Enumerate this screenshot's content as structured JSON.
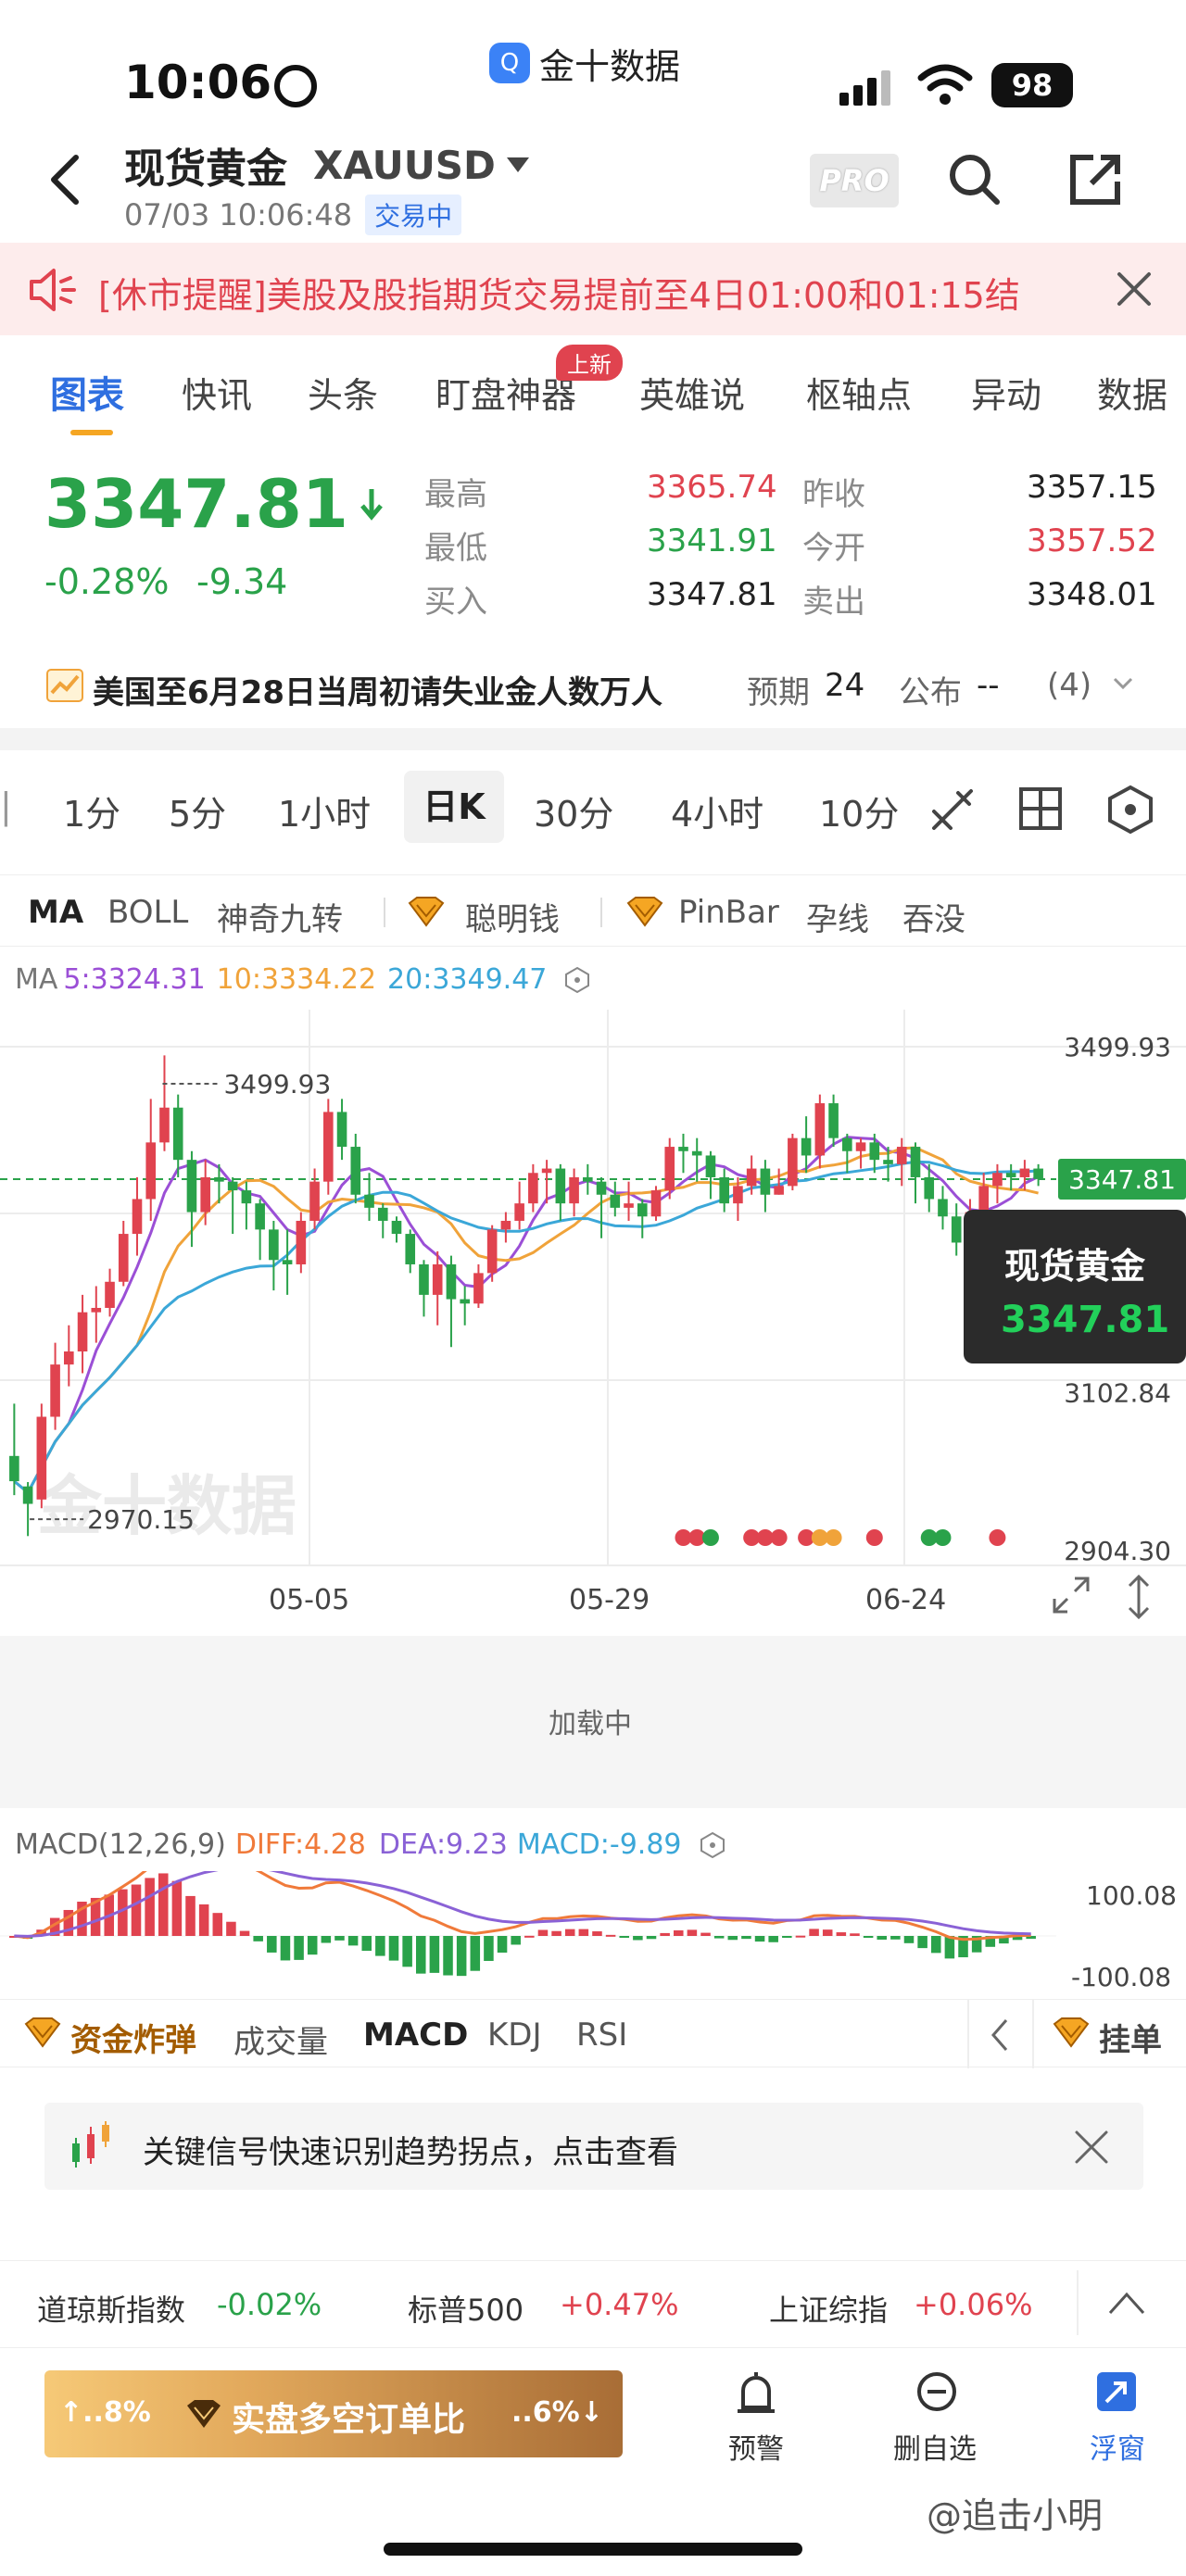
{
  "status_bar": {
    "time": "10:06",
    "app_pill": "金十数据",
    "battery": "98"
  },
  "header": {
    "title": "现货黄金",
    "symbol": "XAUUSD",
    "datetime": "07/03 10:06:48",
    "trading_badge": "交易中",
    "pro_label": "PRO"
  },
  "notice": {
    "text": "[休市提醒]美股及股指期货交易提前至4日01:00和01:15结"
  },
  "tabs": {
    "items": [
      "图表",
      "快讯",
      "头条",
      "盯盘神器",
      "英雄说",
      "枢轴点",
      "异动",
      "数据"
    ],
    "active": "图表",
    "new_badge": "上新"
  },
  "quote": {
    "price": "3347.81",
    "change_pct": "-0.28%",
    "change_abs": "-9.34",
    "stats": [
      {
        "label": "最高",
        "value": "3365.74",
        "color": "#e0434f"
      },
      {
        "label": "昨收",
        "value": "3357.15",
        "color": "#222222"
      },
      {
        "label": "最低",
        "value": "3341.91",
        "color": "#2aa24a"
      },
      {
        "label": "今开",
        "value": "3357.52",
        "color": "#e0434f"
      },
      {
        "label": "买入",
        "value": "3347.81",
        "color": "#222222"
      },
      {
        "label": "卖出",
        "value": "3348.01",
        "color": "#222222"
      }
    ]
  },
  "event": {
    "text": "美国至6月28日当周初请失业金人数万人",
    "expected_label": "预期",
    "expected_value": "24",
    "publish_label": "公布",
    "publish_value": "--",
    "count": "(4)"
  },
  "periods": {
    "items": [
      "1分",
      "5分",
      "1小时",
      "日K",
      "30分",
      "4小时",
      "10分"
    ],
    "active": "日K"
  },
  "indicators": {
    "items": [
      "MA",
      "BOLL",
      "神奇九转",
      "聪明钱",
      "PinBar",
      "孕线",
      "吞没"
    ]
  },
  "chart_data": {
    "type": "candlestick",
    "ma_label": "MA",
    "ma": [
      {
        "name": "5",
        "value": "3324.31",
        "color": "#9b4fd6"
      },
      {
        "name": "10",
        "value": "3334.22",
        "color": "#f0a33a"
      },
      {
        "name": "20",
        "value": "3349.47",
        "color": "#3ba7d8"
      }
    ],
    "y_ticks": [
      "3499.93",
      "3102.84",
      "2904.30"
    ],
    "max_marker": "3499.93",
    "min_marker": "2970.15",
    "current_price": "3347.81",
    "ylim": [
      2904.3,
      3499.93
    ],
    "x_ticks": [
      "05-05",
      "05-29",
      "06-24"
    ],
    "watermark": "金十数据",
    "tooltip_title": "现货黄金",
    "tooltip_value": "3347.81",
    "candles": [
      [
        3030,
        3001,
        3090,
        2985
      ],
      [
        2995,
        2975,
        3000,
        2938
      ],
      [
        2980,
        3075,
        3090,
        2970
      ],
      [
        3075,
        3135,
        3160,
        3060
      ],
      [
        3135,
        3150,
        3180,
        3110
      ],
      [
        3150,
        3195,
        3215,
        3125
      ],
      [
        3195,
        3200,
        3225,
        3160
      ],
      [
        3200,
        3230,
        3245,
        3190
      ],
      [
        3230,
        3285,
        3300,
        3225
      ],
      [
        3285,
        3325,
        3350,
        3260
      ],
      [
        3325,
        3390,
        3440,
        3300
      ],
      [
        3390,
        3430,
        3490,
        3380
      ],
      [
        3430,
        3370,
        3445,
        3350
      ],
      [
        3370,
        3310,
        3380,
        3270
      ],
      [
        3310,
        3350,
        3370,
        3295
      ],
      [
        3350,
        3345,
        3365,
        3320
      ],
      [
        3345,
        3335,
        3350,
        3285
      ],
      [
        3335,
        3320,
        3345,
        3290
      ],
      [
        3320,
        3290,
        3325,
        3255
      ],
      [
        3290,
        3255,
        3300,
        3220
      ],
      [
        3255,
        3250,
        3290,
        3215
      ],
      [
        3250,
        3300,
        3310,
        3240
      ],
      [
        3300,
        3345,
        3360,
        3290
      ],
      [
        3345,
        3425,
        3440,
        3330
      ],
      [
        3425,
        3385,
        3440,
        3370
      ],
      [
        3385,
        3330,
        3400,
        3320
      ],
      [
        3330,
        3315,
        3355,
        3300
      ],
      [
        3315,
        3300,
        3320,
        3280
      ],
      [
        3300,
        3285,
        3305,
        3275
      ],
      [
        3285,
        3250,
        3290,
        3240
      ],
      [
        3250,
        3215,
        3255,
        3190
      ],
      [
        3215,
        3250,
        3265,
        3180
      ],
      [
        3250,
        3210,
        3260,
        3155
      ],
      [
        3210,
        3205,
        3225,
        3180
      ],
      [
        3205,
        3240,
        3250,
        3200
      ],
      [
        3240,
        3290,
        3295,
        3230
      ],
      [
        3290,
        3300,
        3310,
        3275
      ],
      [
        3300,
        3320,
        3345,
        3290
      ],
      [
        3320,
        3355,
        3365,
        3310
      ],
      [
        3355,
        3360,
        3370,
        3320
      ],
      [
        3360,
        3320,
        3365,
        3300
      ],
      [
        3320,
        3350,
        3360,
        3305
      ],
      [
        3350,
        3345,
        3365,
        3330
      ],
      [
        3345,
        3330,
        3350,
        3280
      ],
      [
        3330,
        3315,
        3345,
        3305
      ],
      [
        3315,
        3320,
        3345,
        3300
      ],
      [
        3320,
        3305,
        3325,
        3280
      ],
      [
        3305,
        3335,
        3340,
        3300
      ],
      [
        3335,
        3385,
        3395,
        3325
      ],
      [
        3385,
        3380,
        3400,
        3355
      ],
      [
        3380,
        3375,
        3395,
        3345
      ],
      [
        3375,
        3350,
        3380,
        3325
      ],
      [
        3350,
        3320,
        3360,
        3310
      ],
      [
        3320,
        3340,
        3350,
        3300
      ],
      [
        3340,
        3360,
        3375,
        3330
      ],
      [
        3360,
        3330,
        3370,
        3310
      ],
      [
        3330,
        3340,
        3360,
        3330
      ],
      [
        3340,
        3395,
        3400,
        3335
      ],
      [
        3395,
        3375,
        3420,
        3355
      ],
      [
        3375,
        3435,
        3445,
        3360
      ],
      [
        3435,
        3395,
        3445,
        3385
      ],
      [
        3395,
        3380,
        3400,
        3355
      ],
      [
        3380,
        3390,
        3395,
        3360
      ],
      [
        3390,
        3370,
        3400,
        3355
      ],
      [
        3370,
        3365,
        3385,
        3345
      ],
      [
        3365,
        3385,
        3395,
        3340
      ],
      [
        3385,
        3350,
        3390,
        3320
      ],
      [
        3350,
        3325,
        3365,
        3310
      ],
      [
        3325,
        3305,
        3340,
        3290
      ],
      [
        3305,
        3275,
        3320,
        3260
      ],
      [
        3275,
        3310,
        3325,
        3265
      ],
      [
        3310,
        3340,
        3355,
        3300
      ],
      [
        3340,
        3355,
        3365,
        3320
      ],
      [
        3355,
        3350,
        3365,
        3335
      ],
      [
        3350,
        3360,
        3370,
        3335
      ],
      [
        3360,
        3348,
        3365,
        3340
      ]
    ],
    "event_dots": [
      {
        "i": 49,
        "color": "#e0434f"
      },
      {
        "i": 50,
        "color": "#e0434f"
      },
      {
        "i": 51,
        "color": "#2aa24a"
      },
      {
        "i": 54,
        "color": "#e0434f"
      },
      {
        "i": 55,
        "color": "#e0434f"
      },
      {
        "i": 56,
        "color": "#e0434f"
      },
      {
        "i": 58,
        "color": "#e0434f"
      },
      {
        "i": 59,
        "color": "#f0a33a"
      },
      {
        "i": 60,
        "color": "#f0a33a"
      },
      {
        "i": 63,
        "color": "#e0434f"
      },
      {
        "i": 67,
        "color": "#2aa24a"
      },
      {
        "i": 68,
        "color": "#2aa24a"
      },
      {
        "i": 72,
        "color": "#e0434f"
      }
    ]
  },
  "loading_text": "加载中",
  "macd": {
    "label": "MACD(12,26,9)",
    "diff": "DIFF:4.28",
    "dea": "DEA:9.23",
    "macd": "MACD:-9.89",
    "top": "100.08",
    "bottom": "-100.08"
  },
  "sub_tabs": {
    "bomb": "资金炸弹",
    "items": [
      "成交量",
      "MACD",
      "KDJ",
      "RSI"
    ],
    "active": "MACD",
    "order": "挂单"
  },
  "banner": {
    "text": "关键信号快速识别趋势拐点，点击查看"
  },
  "indices": [
    {
      "name": "道琼斯指数",
      "change": "-0.02%",
      "color": "#2aa24a"
    },
    {
      "name": "标普500",
      "change": "+0.47%",
      "color": "#e0434f"
    },
    {
      "name": "上证综指",
      "change": "+0.06%",
      "color": "#e0434f"
    }
  ],
  "bottom_bar": {
    "long_pct": "↑..8%",
    "ratio_label": "实盘多空订单比",
    "short_pct": "..6%↓",
    "actions": [
      {
        "label": "预警",
        "icon": "alarm-icon"
      },
      {
        "label": "删自选",
        "icon": "minus-circle-icon"
      },
      {
        "label": "浮窗",
        "icon": "float-window-icon"
      }
    ],
    "watermark": "@追击小明"
  }
}
